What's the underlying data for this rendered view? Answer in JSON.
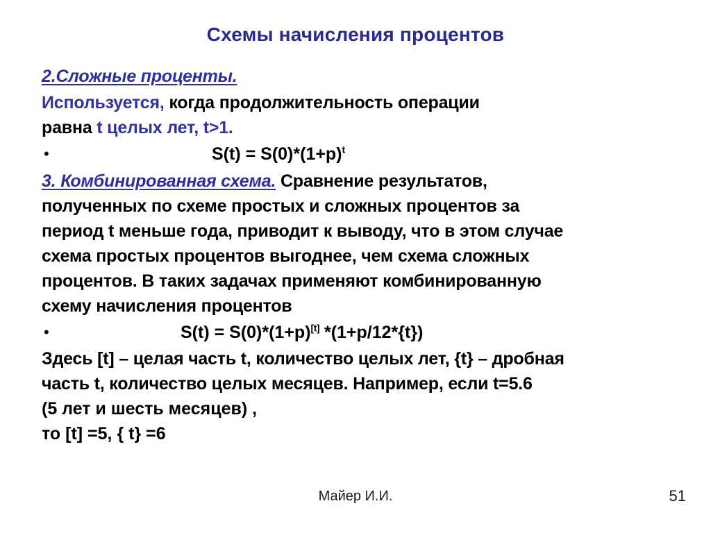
{
  "slide": {
    "title": "Схемы начисления процентов",
    "title_color": "#2a2a8c",
    "accent_blue": "#3333a0",
    "background": "#ffffff"
  },
  "section2": {
    "heading": "2.Сложные проценты.",
    "line1_blue": "Используется,",
    "line1_black": " когда продолжительность операции",
    "line2_black": "равна ",
    "line2_blue": "t целых лет, t>1.",
    "bullet": "•",
    "formula_main": "S(t) = S(0)*(1+p)",
    "formula_sup": "t"
  },
  "section3": {
    "heading": "3. Комбинированная схема.",
    "intro": " Сравнение результатов,",
    "line2": "полученных по схеме простых и сложных процентов за",
    "line3": "период t меньше года, приводит к выводу, что в этом случае",
    "line4": "схема простых процентов выгоднее, чем схема сложных",
    "line5": "процентов. В таких задачах применяют комбинированную",
    "line6": "схему начисления процентов",
    "bullet": "•",
    "formula_part1": "S(t) = S(0)*(1+p)",
    "formula_sup": "[t]",
    "formula_part2": " *(1+p/12*{t})",
    "note1": "Здесь [t] – целая часть t, количество целых лет, {t} – дробная",
    "note2": "часть t, количество целых месяцев. Например, если t=5.6",
    "note3": "(5  лет и шесть месяцев) ,",
    "note4": "то [t] =5, {  t} =6"
  },
  "footer": {
    "author": "Майер И.И.",
    "page_number": "51"
  }
}
